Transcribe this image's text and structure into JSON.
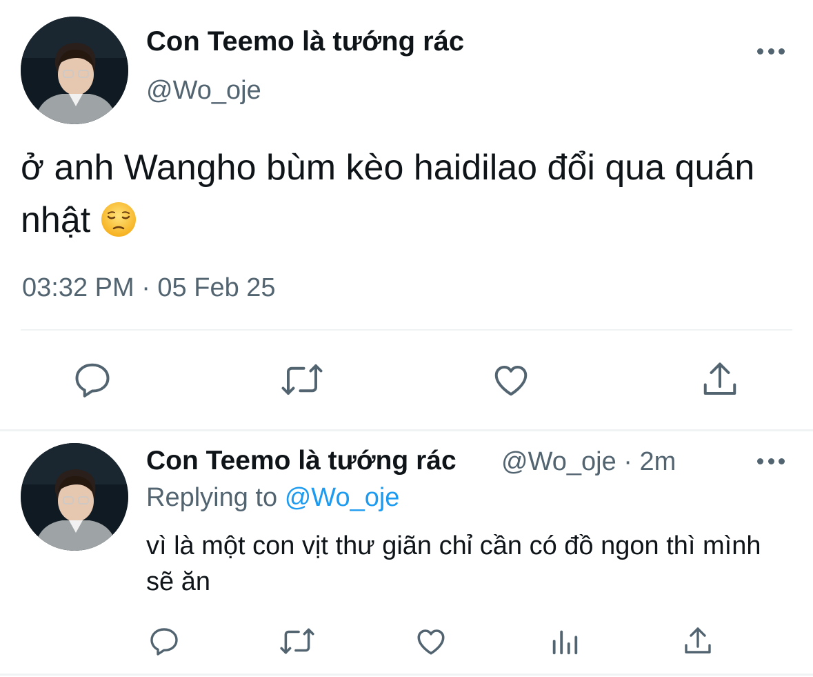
{
  "main_tweet": {
    "display_name": "Con Teemo là tướng rác",
    "handle": "@Wo_oje",
    "text": "ở anh Wangho bùm kèo haidilao đổi qua quán nhật",
    "emoji": "pensive-face",
    "timestamp": "03:32 PM · 05 Feb 25",
    "actions": [
      "reply-icon",
      "retweet-icon",
      "like-icon",
      "share-icon"
    ]
  },
  "reply_tweet": {
    "display_name": "Con Teemo là tướng rác",
    "handle": "@Wo_oje",
    "separator": "·",
    "age": "2m",
    "replying_label": "Replying to",
    "replying_handle": "@Wo_oje",
    "text": "vì là một con vịt thư giãn chỉ cần có đồ ngon thì mình sẽ ăn",
    "actions": [
      "reply-icon",
      "retweet-icon",
      "like-icon",
      "analytics-icon",
      "share-icon"
    ]
  },
  "colors": {
    "text_primary": "#0f1419",
    "text_secondary": "#536471",
    "link": "#1d9bf0",
    "divider": "#eff3f4"
  }
}
